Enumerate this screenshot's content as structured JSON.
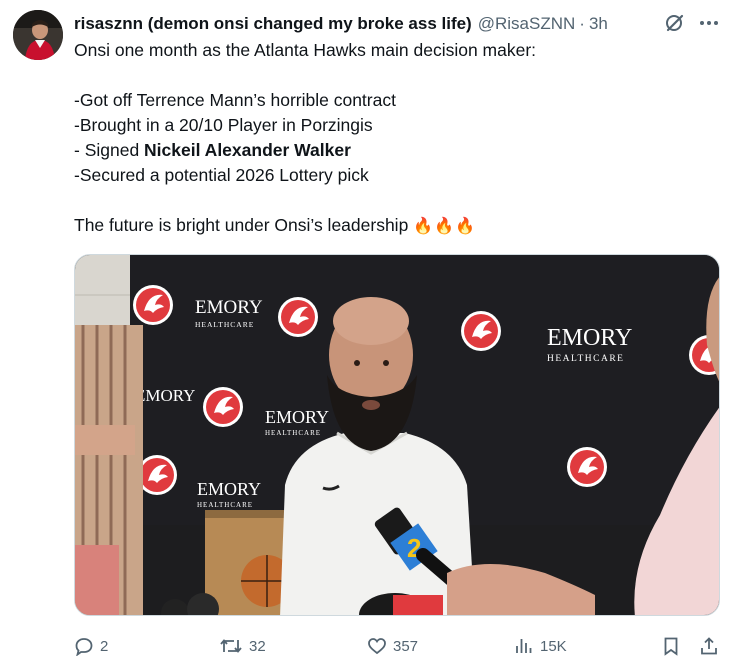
{
  "tweet": {
    "display_name": "risasznn (demon onsi changed my broke ass life)",
    "handle": "@RisaSZNN",
    "separator": "·",
    "time": "3h",
    "lines": [
      "Onsi one month as the Atlanta Hawks main decision maker:",
      "",
      "-Got off Terrence Mann’s horrible contract",
      "-Brought in a 20/10 Player in Porzingis"
    ],
    "signed_prefix": "- Signed ",
    "signed_name": "Nickeil Alexander Walker",
    "lottery_line": "-Secured a potential 2026 Lottery pick",
    "closing_line": "The future is bright under Onsi’s leadership",
    "fire_emojis": "🔥🔥🔥"
  },
  "media": {
    "sponsor_wordmark": "EMORY",
    "sponsor_sub": "HEALTHCARE",
    "mic_label": "2"
  },
  "actions": {
    "replies": "2",
    "reposts": "32",
    "likes": "357",
    "views": "15K"
  },
  "icons": {
    "reply": "reply-icon",
    "repost": "repost-icon",
    "like": "like-icon",
    "views": "views-icon",
    "bookmark": "bookmark-icon",
    "share": "share-icon",
    "grok": "grok-icon",
    "more": "more-icon"
  },
  "colors": {
    "text": "#0f1419",
    "secondary": "#536471",
    "hawks_red": "#e03a3e"
  }
}
